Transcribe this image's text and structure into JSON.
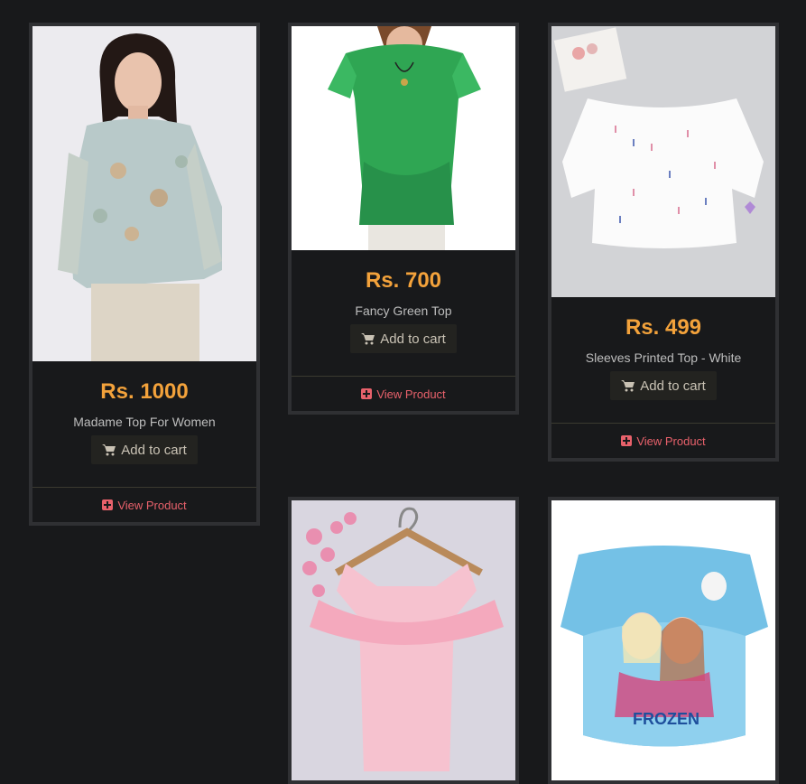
{
  "products": [
    {
      "price": "Rs. 1000",
      "name": "Madame Top For Women",
      "add_to_cart": "Add to cart",
      "view": "View Product"
    },
    {
      "price": "Rs. 700",
      "name": "Fancy Green Top",
      "add_to_cart": "Add to cart",
      "view": "View Product"
    },
    {
      "price": "Rs. 499",
      "name": "Sleeves Printed Top - White",
      "add_to_cart": "Add to cart",
      "view": "View Product"
    }
  ],
  "icons": {
    "cart": "shopping-cart-icon",
    "view": "plus-square-icon"
  },
  "colors": {
    "price": "#f3a23b",
    "link": "#e8616b",
    "background": "#18191b",
    "card_border": "#2f3033"
  }
}
